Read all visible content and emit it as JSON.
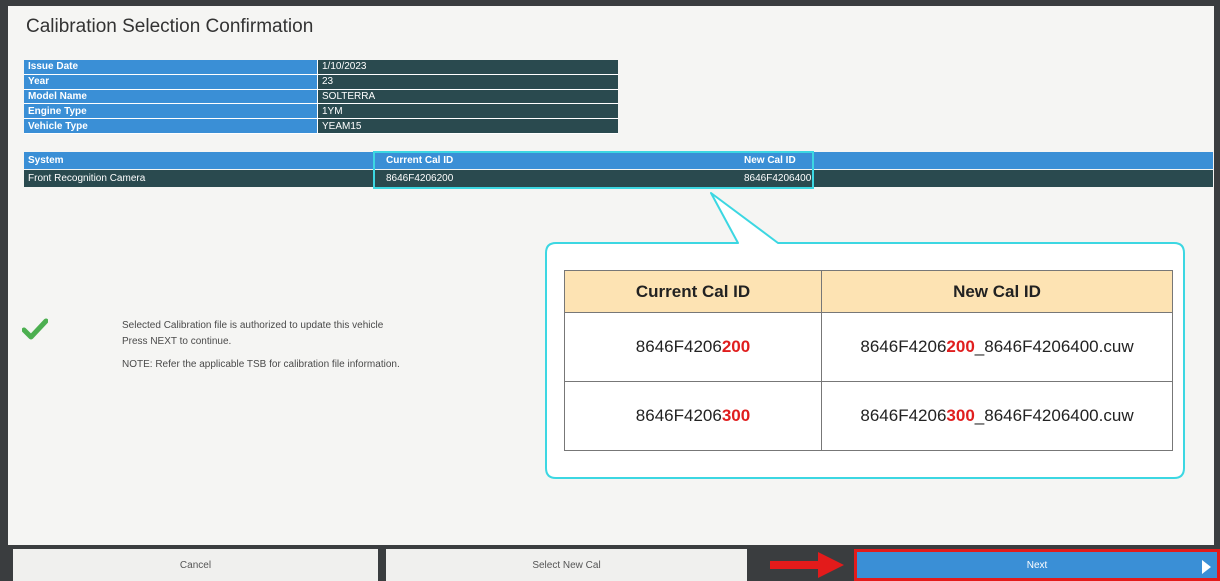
{
  "title": "Calibration Selection Confirmation",
  "vehicle_info": [
    {
      "label": "Issue Date",
      "value": "1/10/2023"
    },
    {
      "label": "Year",
      "value": "23"
    },
    {
      "label": "Model Name",
      "value": "SOLTERRA"
    },
    {
      "label": "Engine Type",
      "value": "1YM"
    },
    {
      "label": "Vehicle Type",
      "value": "YEAM15"
    }
  ],
  "systems_table": {
    "headers": {
      "system": "System",
      "current": "Current Cal ID",
      "new": "New Cal ID"
    },
    "row": {
      "system": "Front Recognition Camera",
      "current": "8646F4206200",
      "new": "8646F4206400"
    }
  },
  "message": {
    "line1": "Selected Calibration file is authorized to update this vehicle",
    "line2": "Press NEXT to continue.",
    "line3": "NOTE: Refer the applicable TSB for calibration file information."
  },
  "callout_table": {
    "headers": {
      "current": "Current Cal ID",
      "new": "New Cal ID"
    },
    "rows": [
      {
        "current_prefix": "8646F4206",
        "current_hl": "200",
        "new_prefix": "8646F4206",
        "new_hl": "200",
        "new_suffix": "_8646F4206400.cuw"
      },
      {
        "current_prefix": "8646F4206",
        "current_hl": "300",
        "new_prefix": "8646F4206",
        "new_hl": "300",
        "new_suffix": "_8646F4206400.cuw"
      }
    ]
  },
  "buttons": {
    "cancel": "Cancel",
    "select_new_cal": "Select New Cal",
    "next": "Next"
  },
  "colors": {
    "header_blue": "#3a8fd6",
    "row_dark": "#2a4a4f",
    "highlight_cyan": "#3cd7e2",
    "accent_red": "#e01e1e",
    "check_green": "#4caf50"
  }
}
